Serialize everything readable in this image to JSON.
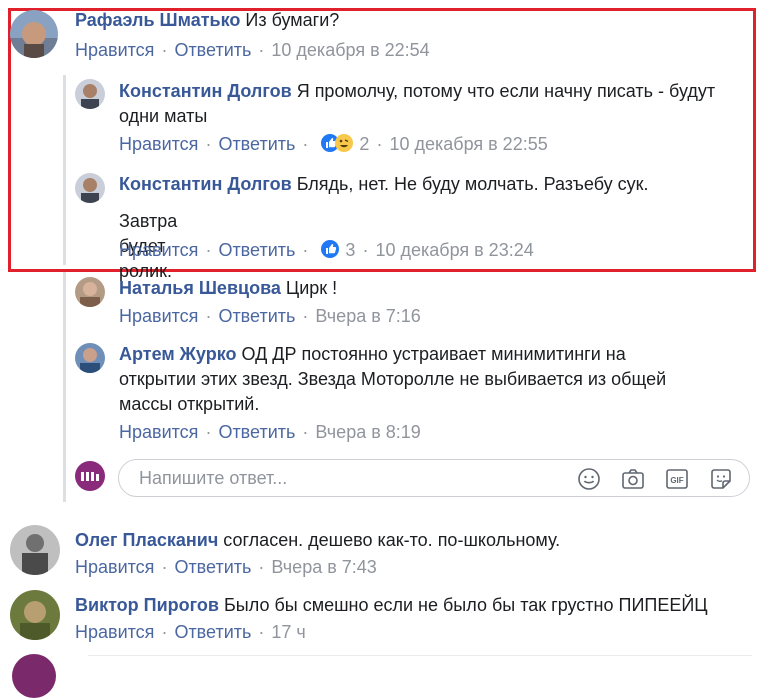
{
  "actions": {
    "like": "Нравится",
    "reply": "Ответить"
  },
  "comments": [
    {
      "author": "Рафаэль Шматько",
      "text": "Из бумаги?",
      "time": "10 декабря в 22:54"
    },
    {
      "author": "Константин Долгов",
      "text": "Я промолчу, потому что если начну писать - будут одни маты",
      "reactions": "2",
      "time": "10 декабря в 22:55"
    },
    {
      "author": "Константин Долгов",
      "text": "Блядь, нет. Не буду молчать. Разъебу сук.",
      "text2": "Завтра будет ролик.",
      "reactions": "3",
      "time": "10 декабря в 23:24"
    },
    {
      "author": "Наталья Шевцова",
      "text": "Цирк !",
      "time": "Вчера в 7:16"
    },
    {
      "author": "Артем Журко",
      "text": "ОД ДР постоянно устраивает минимитинги на открытии этих звезд. Звезда Моторолле не выбивается из общей массы открытий.",
      "time": "Вчера в 8:19"
    },
    {
      "author": "Олег Пласканич",
      "text": "согласен. дешево как-то. по-школьному.",
      "time": "Вчера в 7:43"
    },
    {
      "author": "Виктор Пирогов",
      "text": "Было бы смешно если не было бы так грустно ПИПЕЕЙЦ",
      "time": "17 ч"
    }
  ],
  "reply_box": {
    "placeholder": "Напишите ответ..."
  },
  "colors": {
    "author": "#385898",
    "link": "#4b67a1",
    "meta": "#90949c",
    "highlight": "#e0202a"
  }
}
